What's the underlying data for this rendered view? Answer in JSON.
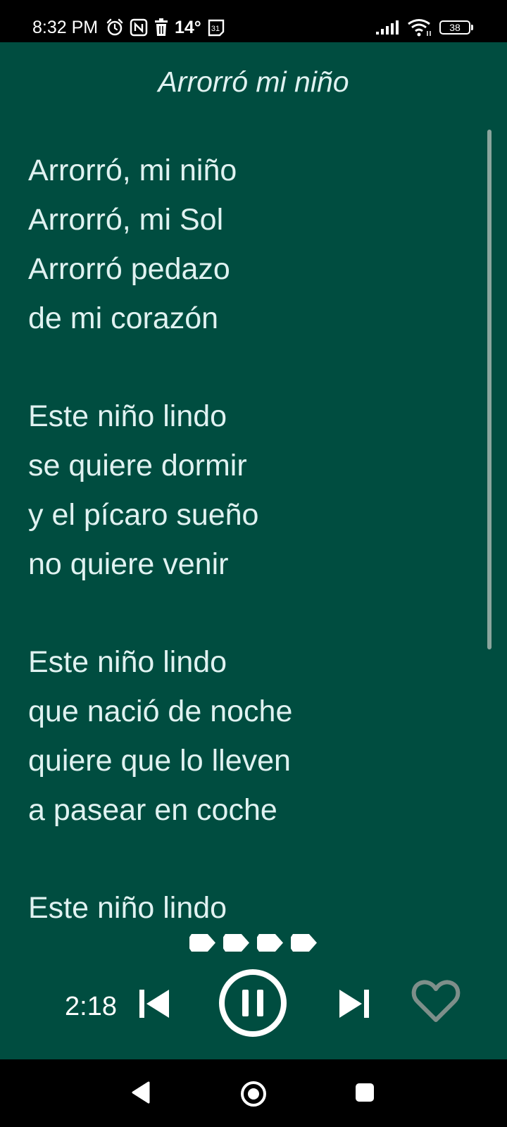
{
  "status_bar": {
    "time": "8:32 PM",
    "temperature": "14°",
    "calendar_day": "31",
    "battery": "38",
    "icons": [
      "alarm-icon",
      "nfc-icon",
      "trash-icon",
      "calendar-icon",
      "signal-icon",
      "wifi-icon",
      "battery-icon"
    ]
  },
  "header": {
    "title": "Arrorró mi niño"
  },
  "lyrics": {
    "stanzas": [
      [
        "Arrorró, mi niño",
        "Arrorró, mi Sol",
        "Arrorró pedazo",
        "de mi corazón"
      ],
      [
        "Este niño lindo",
        "se quiere dormir",
        "y el pícaro sueño",
        "no quiere venir"
      ],
      [
        "Este niño lindo",
        "que nació de noche",
        "quiere que lo lleven",
        "a pasear en coche"
      ],
      [
        "Este niño lindo"
      ]
    ]
  },
  "page_indicator": {
    "count": 4
  },
  "player": {
    "elapsed": "2:18",
    "state": "playing",
    "icons": [
      "skip-previous-icon",
      "pause-icon",
      "skip-next-icon",
      "heart-outline-icon"
    ]
  },
  "navigation_bar": {
    "icons": [
      "back-icon",
      "home-icon",
      "recents-icon"
    ]
  },
  "colors": {
    "background": "#004d40",
    "text": "#e0f2f1",
    "scrollbar": "#8aa59d",
    "favorite_outline": "#7e8f8a"
  }
}
